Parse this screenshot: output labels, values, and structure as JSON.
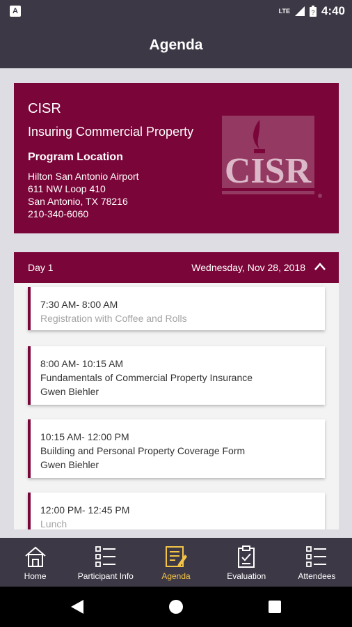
{
  "status_bar": {
    "network": "LTE",
    "time": "4:40"
  },
  "app_bar": {
    "title": "Agenda"
  },
  "hero": {
    "org": "CISR",
    "course": "Insuring Commercial Property",
    "location_title": "Program Location",
    "address": [
      "Hilton San Antonio Airport",
      "611 NW Loop 410",
      "San Antonio, TX 78216",
      "210-340-6060"
    ],
    "logo_text": "CISR"
  },
  "day": {
    "label": "Day 1",
    "date": "Wednesday, Nov 28, 2018"
  },
  "sessions": [
    {
      "time": "7:30 AM- 8:00 AM",
      "title": "Registration with Coffee and Rolls",
      "speaker": ""
    },
    {
      "time": "8:00 AM- 10:15 AM",
      "title": "Fundamentals of Commercial Property Insurance",
      "speaker": "Gwen Biehler"
    },
    {
      "time": "10:15 AM- 12:00 PM",
      "title": "Building and Personal Property Coverage Form",
      "speaker": "Gwen Biehler"
    },
    {
      "time": "12:00 PM- 12:45 PM",
      "title": "Lunch",
      "speaker": ""
    }
  ],
  "nav": {
    "home": "Home",
    "participant": "Participant Info",
    "agenda": "Agenda",
    "evaluation": "Evaluation",
    "attendees": "Attendees"
  },
  "colors": {
    "brand": "#7a0538",
    "bar": "#3d3846",
    "active": "#f3c447"
  }
}
